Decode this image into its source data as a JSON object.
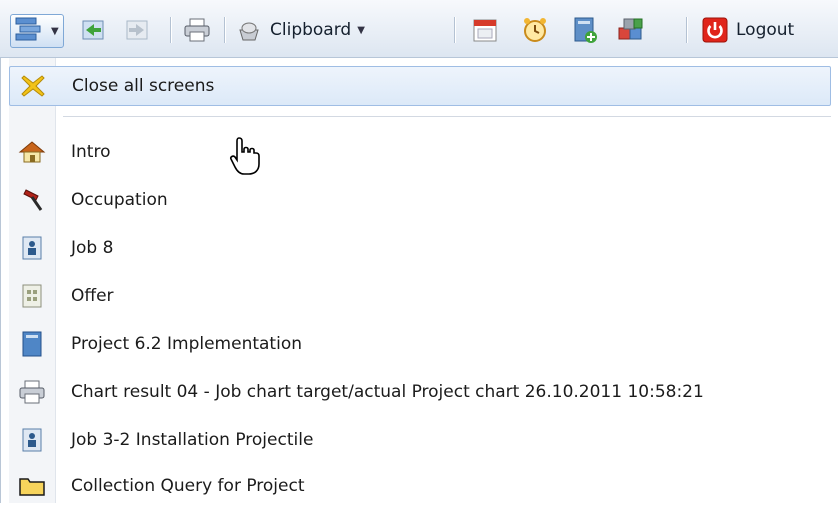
{
  "toolbar": {
    "clipboard_label": "Clipboard",
    "logout_label": "Logout",
    "icons": [
      "screens-menu-icon",
      "back-icon",
      "forward-icon",
      "print-icon",
      "clipboard-icon",
      "calendar-icon",
      "alarm-clock-icon",
      "new-document-icon",
      "modules-icon",
      "power-icon"
    ]
  },
  "menu": {
    "close_all": "Close all screens",
    "items": [
      {
        "label": "Intro",
        "icon": "home-icon"
      },
      {
        "label": "Occupation",
        "icon": "hammer-icon"
      },
      {
        "label": "Job 8",
        "icon": "job-badge-icon"
      },
      {
        "label": "Offer",
        "icon": "offer-icon"
      },
      {
        "label": "Project 6.2 Implementation",
        "icon": "project-book-icon"
      },
      {
        "label": "Chart result 04 - Job chart target/actual Project chart 26.10.2011 10:58:21",
        "icon": "printer-icon"
      },
      {
        "label": "Job 3-2 Installation Projectile",
        "icon": "job-badge-icon"
      },
      {
        "label": "Collection Query for Project",
        "icon": "folder-icon"
      }
    ]
  }
}
